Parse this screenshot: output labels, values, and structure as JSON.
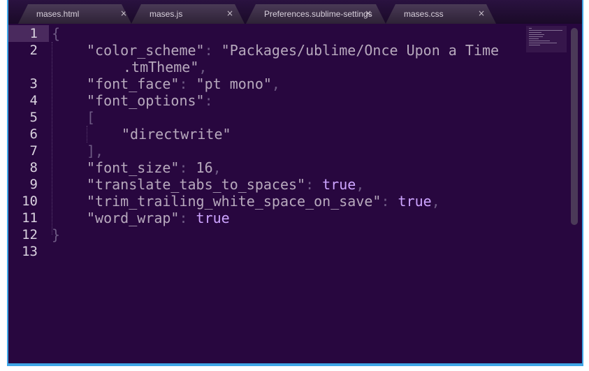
{
  "tabs": [
    {
      "label": "mases.html",
      "close": "×",
      "active": false
    },
    {
      "label": "mases.js",
      "close": "×",
      "active": false
    },
    {
      "label": "Preferences.sublime-settings",
      "close": "×",
      "active": true
    },
    {
      "label": "mases.css",
      "close": "×",
      "active": false
    }
  ],
  "editor": {
    "current_line": 1,
    "line_numbers": [
      "1",
      "2",
      "3",
      "4",
      "5",
      "6",
      "7",
      "8",
      "9",
      "10",
      "11",
      "12",
      "13"
    ],
    "code": {
      "open_brace": "{",
      "color_scheme_key": "\"color_scheme\"",
      "color_scheme_value_a": "\"Packages/ublime/Once Upon a Time",
      "color_scheme_value_b": ".tmTheme\"",
      "font_face_key": "\"font_face\"",
      "font_face_value": "\"pt mono\"",
      "font_options_key": "\"font_options\"",
      "open_bracket": "[",
      "directwrite": "\"directwrite\"",
      "close_bracket": "]",
      "font_size_key": "\"font_size\"",
      "font_size_value": "16",
      "translate_key": "\"translate_tabs_to_spaces\"",
      "translate_value": "true",
      "trim_key": "\"trim_trailing_white_space_on_save\"",
      "trim_value": "true",
      "word_wrap_key": "\"word_wrap\"",
      "word_wrap_value": "true",
      "close_brace": "}",
      "colon": ":",
      "comma": ","
    }
  },
  "colors": {
    "background": "#28073f",
    "frame": "#3fa6e6",
    "string": "#b7a9bd",
    "keyword": "#cda4ff",
    "punctuation": "#6e5a84"
  }
}
